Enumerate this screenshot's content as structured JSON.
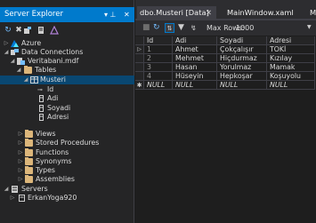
{
  "explorer": {
    "title": "Server Explorer",
    "pin_glyph": "▾ ⊥",
    "close_glyph": "✕",
    "toolbar_icons": [
      "refresh-icon",
      "connect-database-icon",
      "connect-server-icon",
      "azure-connect-icon"
    ],
    "tree": [
      {
        "label": "Azure",
        "icon": "azure-icon",
        "expanded": false
      },
      {
        "label": "Data Connections",
        "icon": "data-connections-icon",
        "expanded": true
      },
      {
        "label": "Veritabani.mdf",
        "icon": "database-icon",
        "expanded": true
      },
      {
        "label": "Tables",
        "icon": "folder-icon",
        "expanded": true
      },
      {
        "label": "Musteri",
        "icon": "table-icon",
        "expanded": true,
        "selected": true
      },
      {
        "label": "Id",
        "icon": "key-icon"
      },
      {
        "label": "Adi",
        "icon": "column-icon"
      },
      {
        "label": "Soyadi",
        "icon": "column-icon"
      },
      {
        "label": "Adresi",
        "icon": "column-icon"
      },
      {
        "label": "Views",
        "icon": "folder-icon",
        "expanded": false
      },
      {
        "label": "Stored Procedures",
        "icon": "folder-icon",
        "expanded": false
      },
      {
        "label": "Functions",
        "icon": "folder-icon",
        "expanded": false
      },
      {
        "label": "Synonyms",
        "icon": "folder-icon",
        "expanded": false
      },
      {
        "label": "Types",
        "icon": "folder-icon",
        "expanded": false
      },
      {
        "label": "Assemblies",
        "icon": "folder-icon",
        "expanded": false
      },
      {
        "label": "Servers",
        "icon": "servers-icon",
        "expanded": true
      },
      {
        "label": "ErkanYoga920",
        "icon": "server-icon",
        "expanded": false
      }
    ]
  },
  "tabs": [
    {
      "label": "dbo.Musteri [Data]",
      "close": "✕",
      "active": true
    },
    {
      "label": "MainWindow.xaml",
      "active": false
    },
    {
      "label": "M",
      "active": false
    }
  ],
  "data_toolbar": {
    "max_rows_label": "Max Rows:",
    "max_rows_value": "1000"
  },
  "grid": {
    "columns": [
      "Id",
      "Adi",
      "Soyadi",
      "Adresi"
    ],
    "rows": [
      [
        "1",
        "Ahmet",
        "Çokçalışır",
        "TOKİ"
      ],
      [
        "2",
        "Mehmet",
        "Hiçdurmaz",
        "Kızılay"
      ],
      [
        "3",
        "Hasan",
        "Yorulmaz",
        "Mamak"
      ],
      [
        "4",
        "Hüseyin",
        "Hepkoşar",
        "Koşuyolu"
      ]
    ],
    "new_row": [
      "NULL",
      "NULL",
      "NULL",
      "NULL"
    ]
  },
  "colors": {
    "accent": "#007acc",
    "selection": "#094771",
    "background": "#1e1e1e"
  }
}
